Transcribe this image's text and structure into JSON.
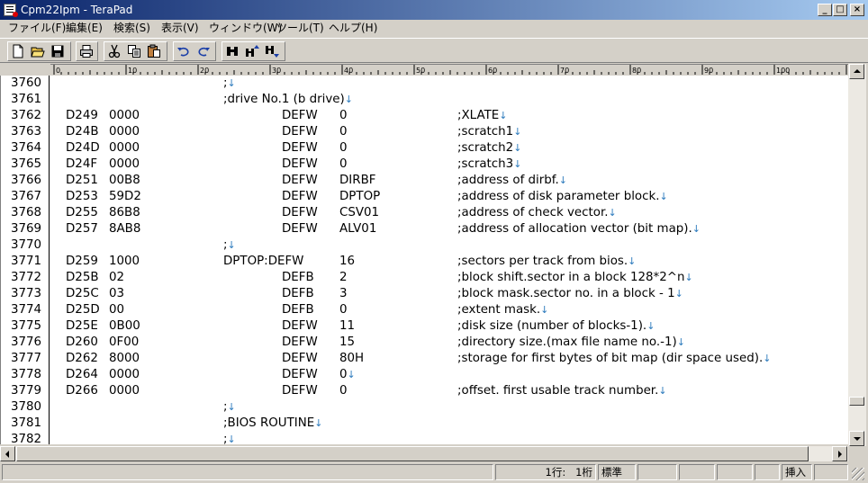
{
  "window": {
    "title": "Cpm22Ipm - TeraPad",
    "min_glyph": "_",
    "max_glyph": "□",
    "close_glyph": "×"
  },
  "menu": [
    {
      "label": "ファイル(F)"
    },
    {
      "label": "編集(E)"
    },
    {
      "label": "検索(S)"
    },
    {
      "label": "表示(V)"
    },
    {
      "label": "ウィンドウ(W)"
    },
    {
      "label": "ツール(T)"
    },
    {
      "label": "ヘルプ(H)"
    }
  ],
  "toolbar": {
    "new_icon": "new-file-icon",
    "open_icon": "open-folder-icon",
    "save_icon": "save-icon",
    "print_icon": "printer-icon",
    "cut_icon": "scissors-icon",
    "copy_icon": "copy-icon",
    "paste_icon": "paste-icon",
    "undo_icon": "undo-icon",
    "redo_icon": "redo-icon",
    "find_icon": "binoculars-icon",
    "find_prev_icon": "find-up-icon",
    "find_next_icon": "find-down-icon"
  },
  "ruler": {
    "labels": [
      "0",
      "10",
      "20",
      "30",
      "40",
      "50",
      "60",
      "70",
      "80",
      "90",
      "100"
    ]
  },
  "editor": {
    "eol_mark": "↓",
    "lines": [
      {
        "num": "3760",
        "addr": "",
        "val": "",
        "label": ";",
        "op": "",
        "arg": "",
        "comment": "",
        "eol": true
      },
      {
        "num": "3761",
        "addr": "",
        "val": "",
        "label": ";drive No.1 (b drive)",
        "op": "",
        "arg": "",
        "comment": "",
        "eol": true
      },
      {
        "num": "3762",
        "addr": "D249",
        "val": "0000",
        "label": "",
        "op": "DEFW",
        "arg": "0",
        "comment": ";XLATE",
        "eol": true
      },
      {
        "num": "3763",
        "addr": "D24B",
        "val": "0000",
        "label": "",
        "op": "DEFW",
        "arg": "0",
        "comment": ";scratch1",
        "eol": true
      },
      {
        "num": "3764",
        "addr": "D24D",
        "val": "0000",
        "label": "",
        "op": "DEFW",
        "arg": "0",
        "comment": ";scratch2",
        "eol": true
      },
      {
        "num": "3765",
        "addr": "D24F",
        "val": "0000",
        "label": "",
        "op": "DEFW",
        "arg": "0",
        "comment": ";scratch3",
        "eol": true
      },
      {
        "num": "3766",
        "addr": "D251",
        "val": "00B8",
        "label": "",
        "op": "DEFW",
        "arg": "DIRBF",
        "comment": ";address of dirbf.",
        "eol": true
      },
      {
        "num": "3767",
        "addr": "D253",
        "val": "59D2",
        "label": "",
        "op": "DEFW",
        "arg": "DPTOP",
        "comment": ";address of disk parameter block.",
        "eol": true
      },
      {
        "num": "3768",
        "addr": "D255",
        "val": "86B8",
        "label": "",
        "op": "DEFW",
        "arg": "CSV01",
        "comment": ";address of check vector.",
        "eol": true
      },
      {
        "num": "3769",
        "addr": "D257",
        "val": "8AB8",
        "label": "",
        "op": "DEFW",
        "arg": "ALV01",
        "comment": ";address of allocation vector (bit map).",
        "eol": true
      },
      {
        "num": "3770",
        "addr": "",
        "val": "",
        "label": ";",
        "op": "",
        "arg": "",
        "comment": "",
        "eol": true
      },
      {
        "num": "3771",
        "addr": "D259",
        "val": "1000",
        "label": "DPTOP:DEFW",
        "op": "",
        "arg": "16",
        "comment": ";sectors per track from bios.",
        "eol": true
      },
      {
        "num": "3772",
        "addr": "D25B",
        "val": "02",
        "label": "",
        "op": "DEFB",
        "arg": "2",
        "comment": ";block shift.sector in a block 128*2^n",
        "eol": true
      },
      {
        "num": "3773",
        "addr": "D25C",
        "val": "03",
        "label": "",
        "op": "DEFB",
        "arg": "3",
        "comment": ";block mask.sector no. in a block - 1",
        "eol": true
      },
      {
        "num": "3774",
        "addr": "D25D",
        "val": "00",
        "label": "",
        "op": "DEFB",
        "arg": "0",
        "comment": ";extent mask.",
        "eol": true
      },
      {
        "num": "3775",
        "addr": "D25E",
        "val": "0B00",
        "label": "",
        "op": "DEFW",
        "arg": "11",
        "comment": ";disk size (number of blocks-1).",
        "eol": true
      },
      {
        "num": "3776",
        "addr": "D260",
        "val": "0F00",
        "label": "",
        "op": "DEFW",
        "arg": "15",
        "comment": ";directory size.(max file name no.-1)",
        "eol": true
      },
      {
        "num": "3777",
        "addr": "D262",
        "val": "8000",
        "label": "",
        "op": "DEFW",
        "arg": "80H",
        "comment": ";storage for first bytes of bit map (dir space used).",
        "eol": true
      },
      {
        "num": "3778",
        "addr": "D264",
        "val": "0000",
        "label": "",
        "op": "DEFW",
        "arg": "0",
        "comment": "",
        "eol": true
      },
      {
        "num": "3779",
        "addr": "D266",
        "val": "0000",
        "label": "",
        "op": "DEFW",
        "arg": "0",
        "comment": ";offset. first usable track number.",
        "eol": true
      },
      {
        "num": "3780",
        "addr": "",
        "val": "",
        "label": ";",
        "op": "",
        "arg": "",
        "comment": "",
        "eol": true
      },
      {
        "num": "3781",
        "addr": "",
        "val": "",
        "label": ";BIOS ROUTINE",
        "op": "",
        "arg": "",
        "comment": "",
        "eol": true
      },
      {
        "num": "3782",
        "addr": "",
        "val": "",
        "label": ";",
        "op": "",
        "arg": "",
        "comment": "",
        "eol": true
      }
    ]
  },
  "status": {
    "line": "1行:",
    "col": "1桁",
    "encoding": "標準",
    "mode": "挿入"
  }
}
